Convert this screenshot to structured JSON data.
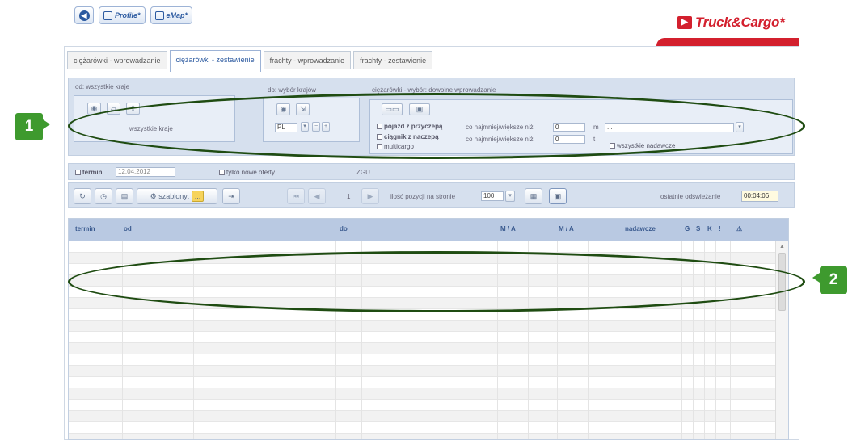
{
  "topbar": {
    "profile_label": "Profile*",
    "emap_label": "eMap*"
  },
  "brand": {
    "name": "Truck&Cargo*",
    "accent": "#d3202e"
  },
  "tabs": [
    {
      "label": "ciężarówki - wprowadzanie"
    },
    {
      "label": "ciężarówki - zestawienie",
      "active": true
    },
    {
      "label": "frachty - wprowadzanie"
    },
    {
      "label": "frachty - zestawienie"
    }
  ],
  "filters": {
    "from_label": "od: wszystkie kraje",
    "from_value": "wszystkie kraje",
    "to_label": "do: wybór krajów",
    "to_country": "PL",
    "trucks_label": "ciężarówki - wybór: dowolne wprowadzanie",
    "vehicle_trailer": "pojazd z przyczepą",
    "tractor_semi": "ciągnik z naczepą",
    "third_option": "multicargo",
    "min_max_label": "co najmniej/większe niż",
    "min_value_1": "0",
    "min_value_2": "0",
    "unit_m": "m",
    "unit_t": "t",
    "dropdown_value": "...",
    "all_senders": "wszystkie nadawcze"
  },
  "row2": {
    "term_label": "termin",
    "term_value": "12.04.2012",
    "only_new_label": "tylko nowe oferty",
    "zgu_label": "ZGU"
  },
  "toolbar": {
    "templates_label": "szablony:",
    "templates_value": "...",
    "page_number": "1",
    "per_page_label": "ilość pozycji na stronie",
    "per_page_value": "100",
    "last_refresh_label": "ostatnie odświeżanie",
    "last_refresh_value": "00:04:06"
  },
  "grid": {
    "columns": [
      "termin",
      "od",
      "do",
      "M / A",
      "M / A",
      "nadawcze",
      "G",
      "S",
      "K",
      "!",
      "⚠"
    ]
  },
  "callouts": {
    "one": "1",
    "two": "2"
  },
  "colors": {
    "ellipse": "#1f4c12",
    "callout": "#3e9a2e",
    "header": "#b9c9e2"
  }
}
